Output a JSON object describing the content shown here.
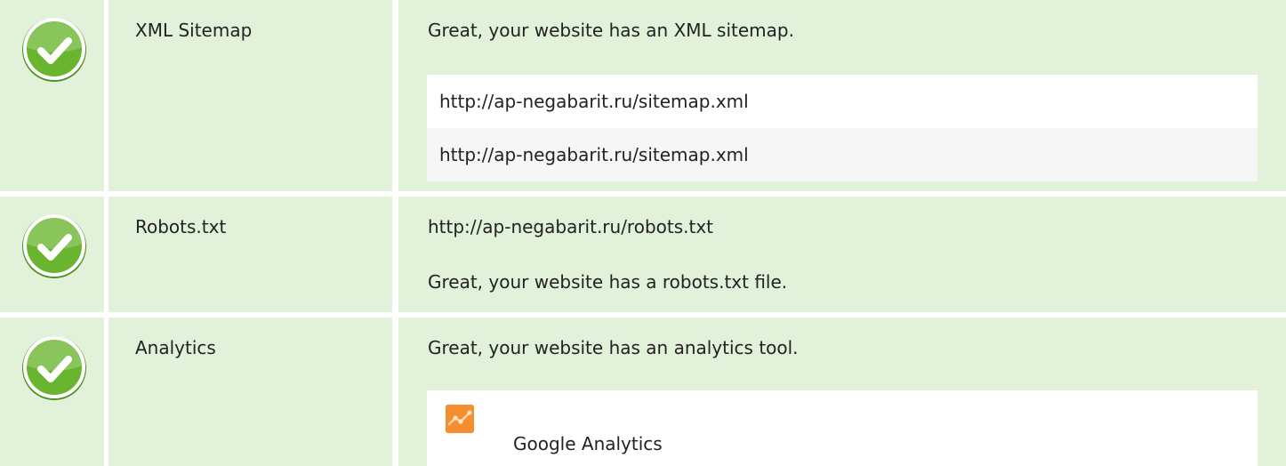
{
  "rows": [
    {
      "name": "XML Sitemap",
      "status": "passed",
      "message": "Great, your website has an XML sitemap.",
      "urls": [
        "http://ap-negabarit.ru/sitemap.xml",
        "http://ap-negabarit.ru/sitemap.xml"
      ]
    },
    {
      "name": "Robots.txt",
      "status": "passed",
      "url": "http://ap-negabarit.ru/robots.txt",
      "message": "Great, your website has a robots.txt file."
    },
    {
      "name": "Analytics",
      "status": "passed",
      "message": "Great, your website has an analytics tool.",
      "tools": [
        {
          "name": "Google Analytics",
          "icon": "google-analytics-icon"
        }
      ]
    }
  ],
  "colors": {
    "row_background": "#e2f1d9",
    "check_green": "#6ab52f",
    "check_border": "#ffffff",
    "alt_row": "#f6f6f6",
    "google_analytics": "#f58e2e"
  }
}
